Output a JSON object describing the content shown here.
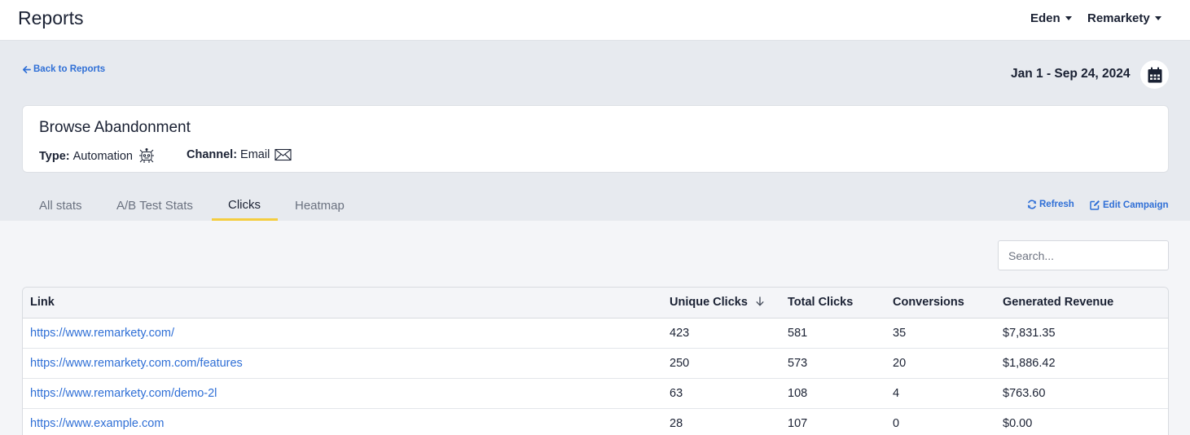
{
  "header": {
    "title": "Reports",
    "user_menu": "Eden",
    "store_menu": "Remarkety"
  },
  "nav": {
    "back_label": "Back to Reports",
    "date_range": "Jan 1 - Sep 24, 2024"
  },
  "campaign": {
    "name": "Browse Abandonment",
    "type_label": "Type:",
    "type_value": "Automation",
    "channel_label": "Channel:",
    "channel_value": "Email"
  },
  "tabs": [
    {
      "label": "All stats",
      "active": false
    },
    {
      "label": "A/B Test Stats",
      "active": false
    },
    {
      "label": "Clicks",
      "active": true
    },
    {
      "label": "Heatmap",
      "active": false
    }
  ],
  "actions": {
    "refresh": "Refresh",
    "edit": "Edit Campaign"
  },
  "search": {
    "placeholder": "Search...",
    "value": ""
  },
  "table": {
    "columns": [
      "Link",
      "Unique Clicks",
      "Total Clicks",
      "Conversions",
      "Generated Revenue"
    ],
    "sorted_column": "Unique Clicks",
    "sort_direction": "desc",
    "rows": [
      {
        "link": "https://www.remarkety.com/",
        "unique": "423",
        "total": "581",
        "conversions": "35",
        "revenue": "$7,831.35"
      },
      {
        "link": "https://www.remarkety.com.com/features",
        "unique": "250",
        "total": "573",
        "conversions": "20",
        "revenue": "$1,886.42"
      },
      {
        "link": "https://www.remarkety.com/demo-2l",
        "unique": "63",
        "total": "108",
        "conversions": "4",
        "revenue": "$763.60"
      },
      {
        "link": "https://www.example.com",
        "unique": "28",
        "total": "107",
        "conversions": "0",
        "revenue": "$0.00"
      }
    ]
  },
  "colors": {
    "accent": "#2f6fd6",
    "tab_indicator": "#f4cd3f",
    "background": "#e7eaef"
  },
  "icons": {
    "back": "arrow-left-icon",
    "calendar": "calendar-icon",
    "automation": "automation-robot-icon",
    "email": "envelope-icon",
    "refresh": "refresh-icon",
    "edit": "edit-icon",
    "sort": "arrow-down-icon"
  }
}
